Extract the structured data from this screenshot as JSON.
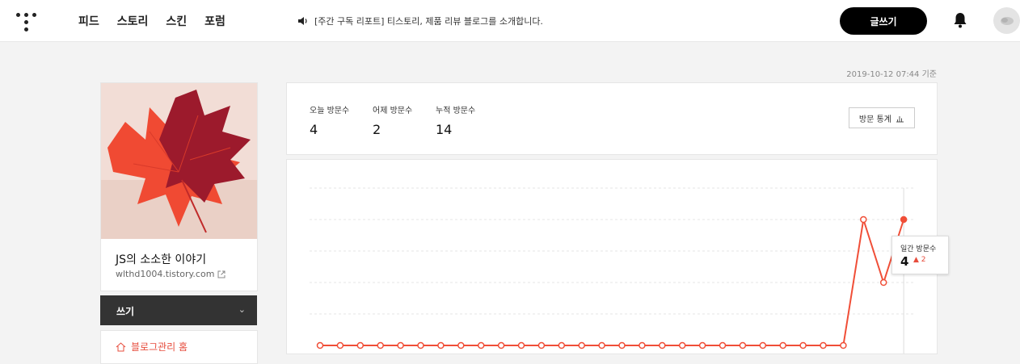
{
  "nav": {
    "items": [
      {
        "label": "피드"
      },
      {
        "label": "스토리"
      },
      {
        "label": "스킨"
      },
      {
        "label": "포럼"
      }
    ]
  },
  "notice": {
    "text": "[주간 구독 리포트] 티스토리, 제품 리뷰 블로그를 소개합니다."
  },
  "header": {
    "write_label": "글쓰기"
  },
  "timestamp": "2019-10-12 07:44 기준",
  "profile": {
    "blog_name": "JS의 소소한 이야기",
    "blog_url": "wlthd1004.tistory.com"
  },
  "menu": {
    "write_label": "쓰기",
    "manage_label": "블로그관리 홈"
  },
  "stats": {
    "items": [
      {
        "label": "오늘 방문수",
        "value": "4"
      },
      {
        "label": "어제 방문수",
        "value": "2"
      },
      {
        "label": "누적 방문수",
        "value": "14"
      }
    ],
    "button_label": "방문 통계"
  },
  "tooltip": {
    "title": "일간 방문수",
    "value": "4",
    "delta": "2"
  },
  "colors": {
    "accent": "#f04e37",
    "topbar": "#ffffff",
    "dark_menu": "#333333"
  },
  "chart_data": {
    "type": "line",
    "series": [
      {
        "values": [
          0,
          0,
          0,
          0,
          0,
          0,
          0,
          0,
          0,
          0,
          0,
          0,
          0,
          0,
          0,
          0,
          0,
          0,
          0,
          0,
          0,
          0,
          0,
          0,
          0,
          0,
          0,
          4,
          2,
          4
        ]
      }
    ],
    "ylim": [
      0,
      5
    ],
    "grid": true
  }
}
